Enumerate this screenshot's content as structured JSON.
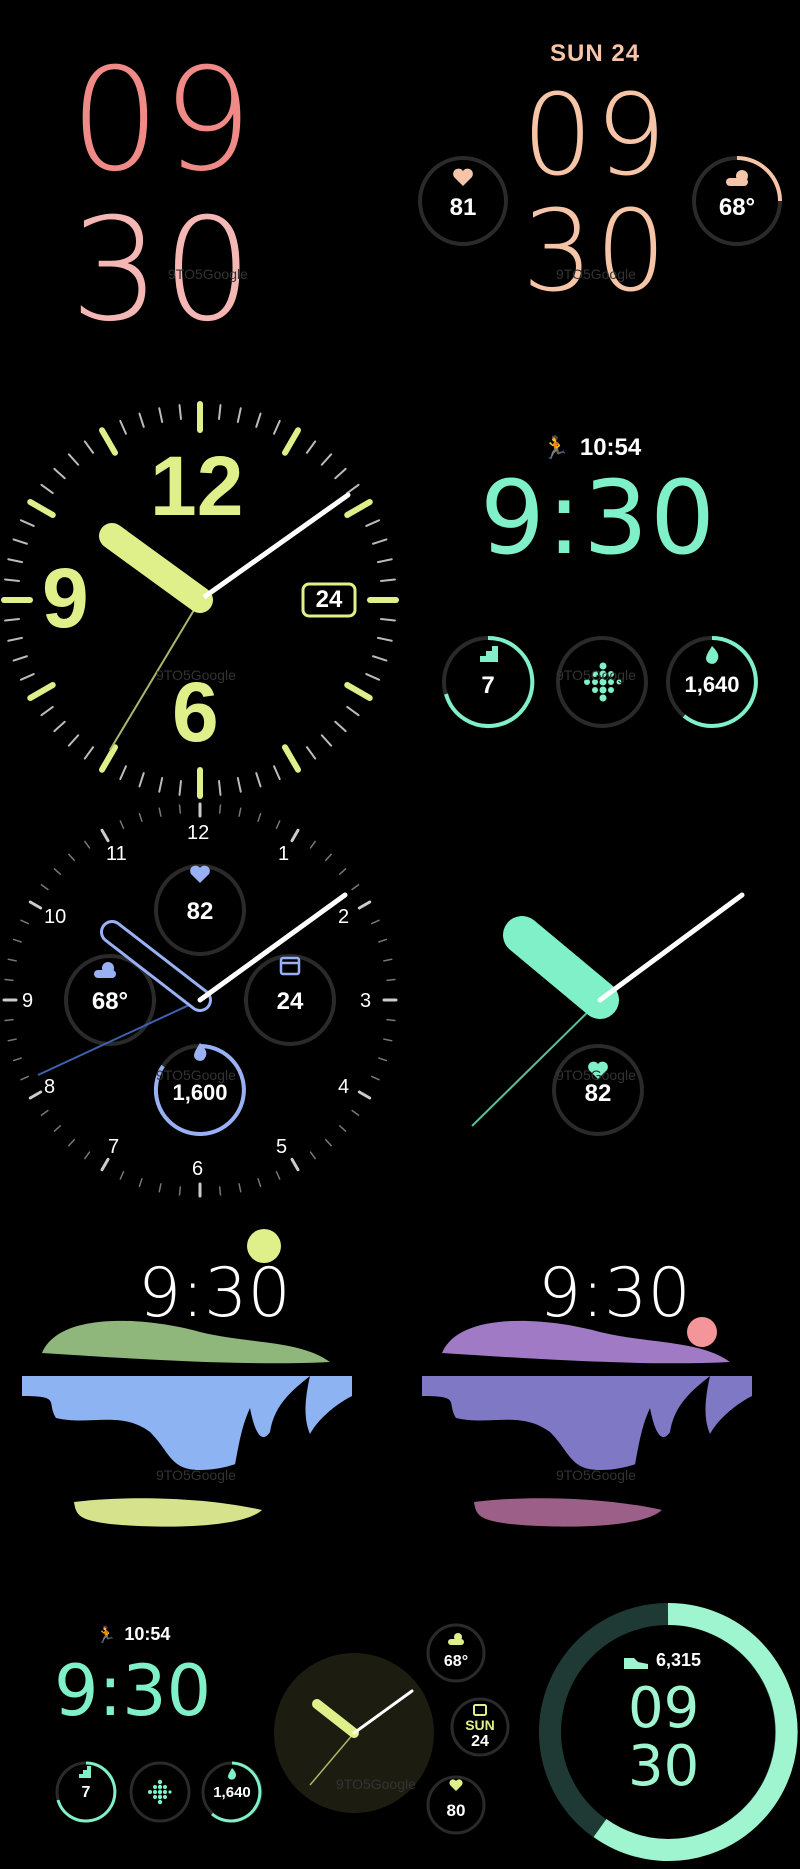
{
  "watermark": "9TO5Google",
  "face1": {
    "hours": "09",
    "minutes": "30"
  },
  "face2": {
    "date": "SUN 24",
    "hours": "09",
    "minutes": "30",
    "heart_rate": "81",
    "weather": "68°"
  },
  "face3": {
    "num_12": "12",
    "num_9": "9",
    "num_6": "6",
    "date": "24"
  },
  "face4": {
    "time_small": "10:54",
    "time": "9:30",
    "steps": "7",
    "calories": "1,640"
  },
  "face5": {
    "numerals": [
      "12",
      "1",
      "2",
      "3",
      "4",
      "5",
      "6",
      "7",
      "8",
      "9",
      "10",
      "11"
    ],
    "heart_rate": "82",
    "weather": "68°",
    "date": "24",
    "calories": "1,600"
  },
  "face6": {
    "heart_rate": "82"
  },
  "face7": {
    "time": "9:30"
  },
  "face8": {
    "time": "9:30"
  },
  "face9": {
    "time_small": "10:54",
    "time": "9:30",
    "steps": "7",
    "calories": "1,640"
  },
  "face10": {
    "weather": "68°",
    "date_day": "SUN",
    "date_num": "24",
    "heart_rate": "80"
  },
  "face11": {
    "steps": "6,315",
    "hours": "09",
    "minutes": "30"
  },
  "colors": {
    "coral": "#f08a86",
    "peach": "#f6c4a6",
    "lime": "#dff08a",
    "mint": "#7ff0c8",
    "periwinkle": "#9ab0f4",
    "green_land": "#8fb77c",
    "blue_water": "#8db3f2",
    "purple_land": "#a07ac4",
    "indigo_water": "#7f78c4",
    "yellow_land": "#d6e28c",
    "rose_land": "#9c5f88"
  }
}
